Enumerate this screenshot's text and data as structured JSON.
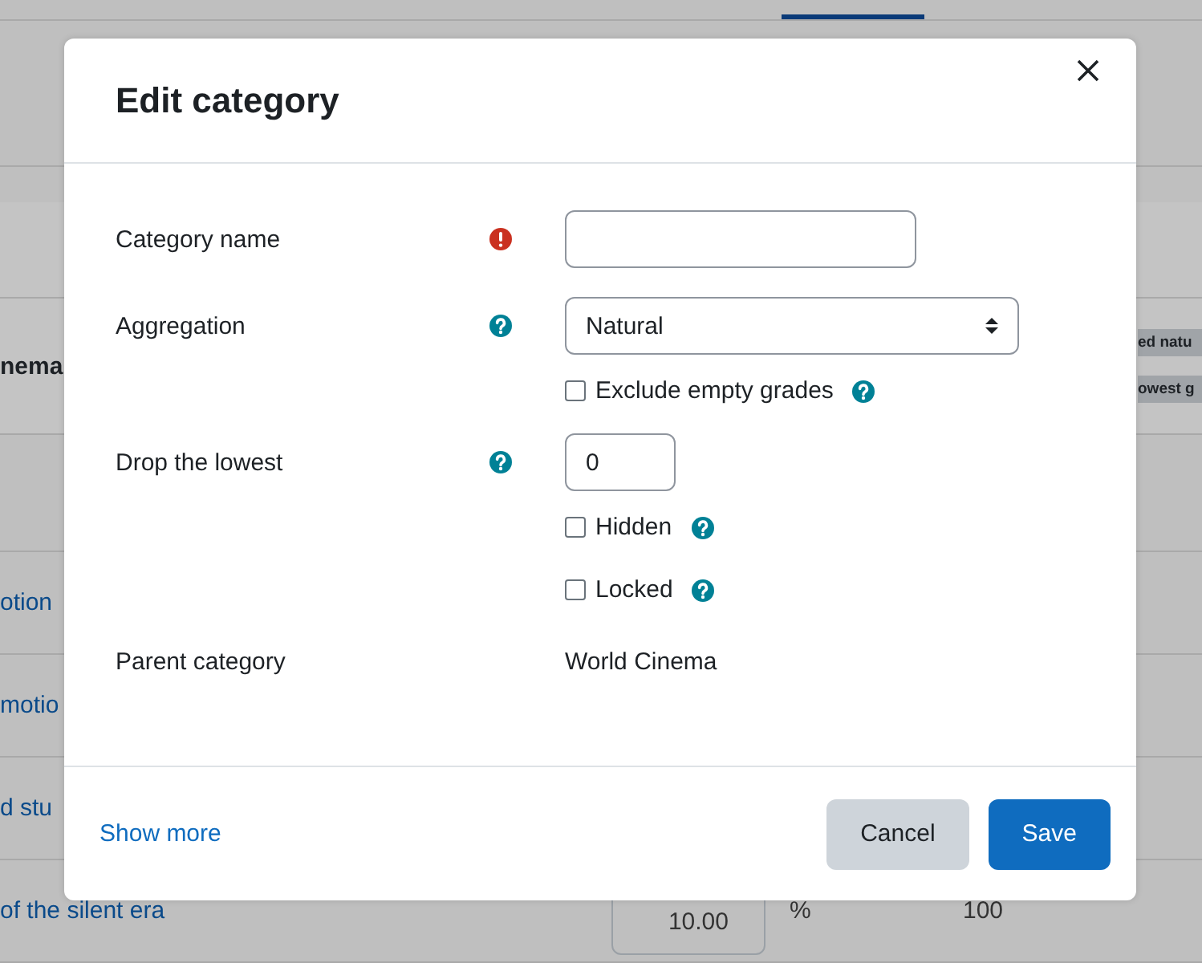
{
  "background": {
    "rows": [
      {
        "kind": "category",
        "name": "nema",
        "badges": [
          "ed natu",
          "owest g"
        ]
      },
      {
        "kind": "blank"
      },
      {
        "kind": "item",
        "name": "otion"
      },
      {
        "kind": "item",
        "name": "motio"
      },
      {
        "kind": "item",
        "name": "d stu"
      },
      {
        "kind": "item",
        "name": "of the silent era",
        "weight": "10.00",
        "unit": "%",
        "max": "100"
      }
    ]
  },
  "modal": {
    "title": "Edit category",
    "fields": [
      {
        "label": "Category name",
        "required": true,
        "help": false,
        "control": {
          "kind": "text"
        }
      },
      {
        "label": "Aggregation",
        "required": false,
        "help": true,
        "control": {
          "kind": "select",
          "value": "Natural"
        },
        "checkboxes": [
          {
            "label": "Exclude empty grades",
            "checked": false,
            "help": true
          }
        ]
      },
      {
        "label": "Drop the lowest",
        "required": false,
        "help": true,
        "control": {
          "kind": "number",
          "value": "0"
        },
        "checkboxes": [
          {
            "label": "Hidden",
            "checked": false,
            "help": true
          },
          {
            "label": "Locked",
            "checked": false,
            "help": true
          }
        ]
      },
      {
        "label": "Parent category",
        "required": false,
        "help": false,
        "control": {
          "kind": "static",
          "value": "World Cinema"
        }
      }
    ],
    "footer": {
      "link": "Show more",
      "buttons": [
        {
          "label": "Cancel",
          "kind": "secondary"
        },
        {
          "label": "Save",
          "kind": "primary"
        }
      ]
    }
  }
}
